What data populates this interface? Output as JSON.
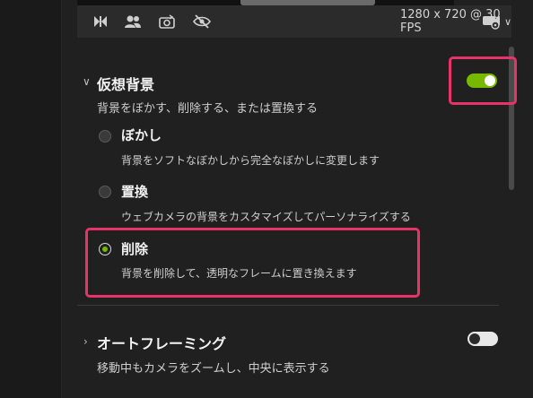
{
  "toolbar": {
    "icons": [
      "media-controls-icon",
      "people-icon",
      "camera-switch-icon",
      "visibility-off-icon"
    ],
    "resolution": "1280 x 720 @ 30 FPS",
    "settings_icon": "camera-settings-icon"
  },
  "virtual_background": {
    "title": "仮想背景",
    "description": "背景をぼかす、削除する、または置換する",
    "enabled": true,
    "options": [
      {
        "title": "ぼかし",
        "description": "背景をソフトなぼかしから完全なぼかしに変更します",
        "selected": false
      },
      {
        "title": "置換",
        "description": "ウェブカメラの背景をカスタマイズしてパーソナライズする",
        "selected": false
      },
      {
        "title": "削除",
        "description": "背景を削除して、透明なフレームに置き換えます",
        "selected": true
      }
    ]
  },
  "auto_framing": {
    "title": "オートフレーミング",
    "description": "移動中もカメラをズームし、中央に表示する",
    "enabled": false
  },
  "colors": {
    "accent": "#76b900",
    "highlight": "#e8336a",
    "panel": "#202020",
    "toolbar": "#2b2b2b"
  }
}
